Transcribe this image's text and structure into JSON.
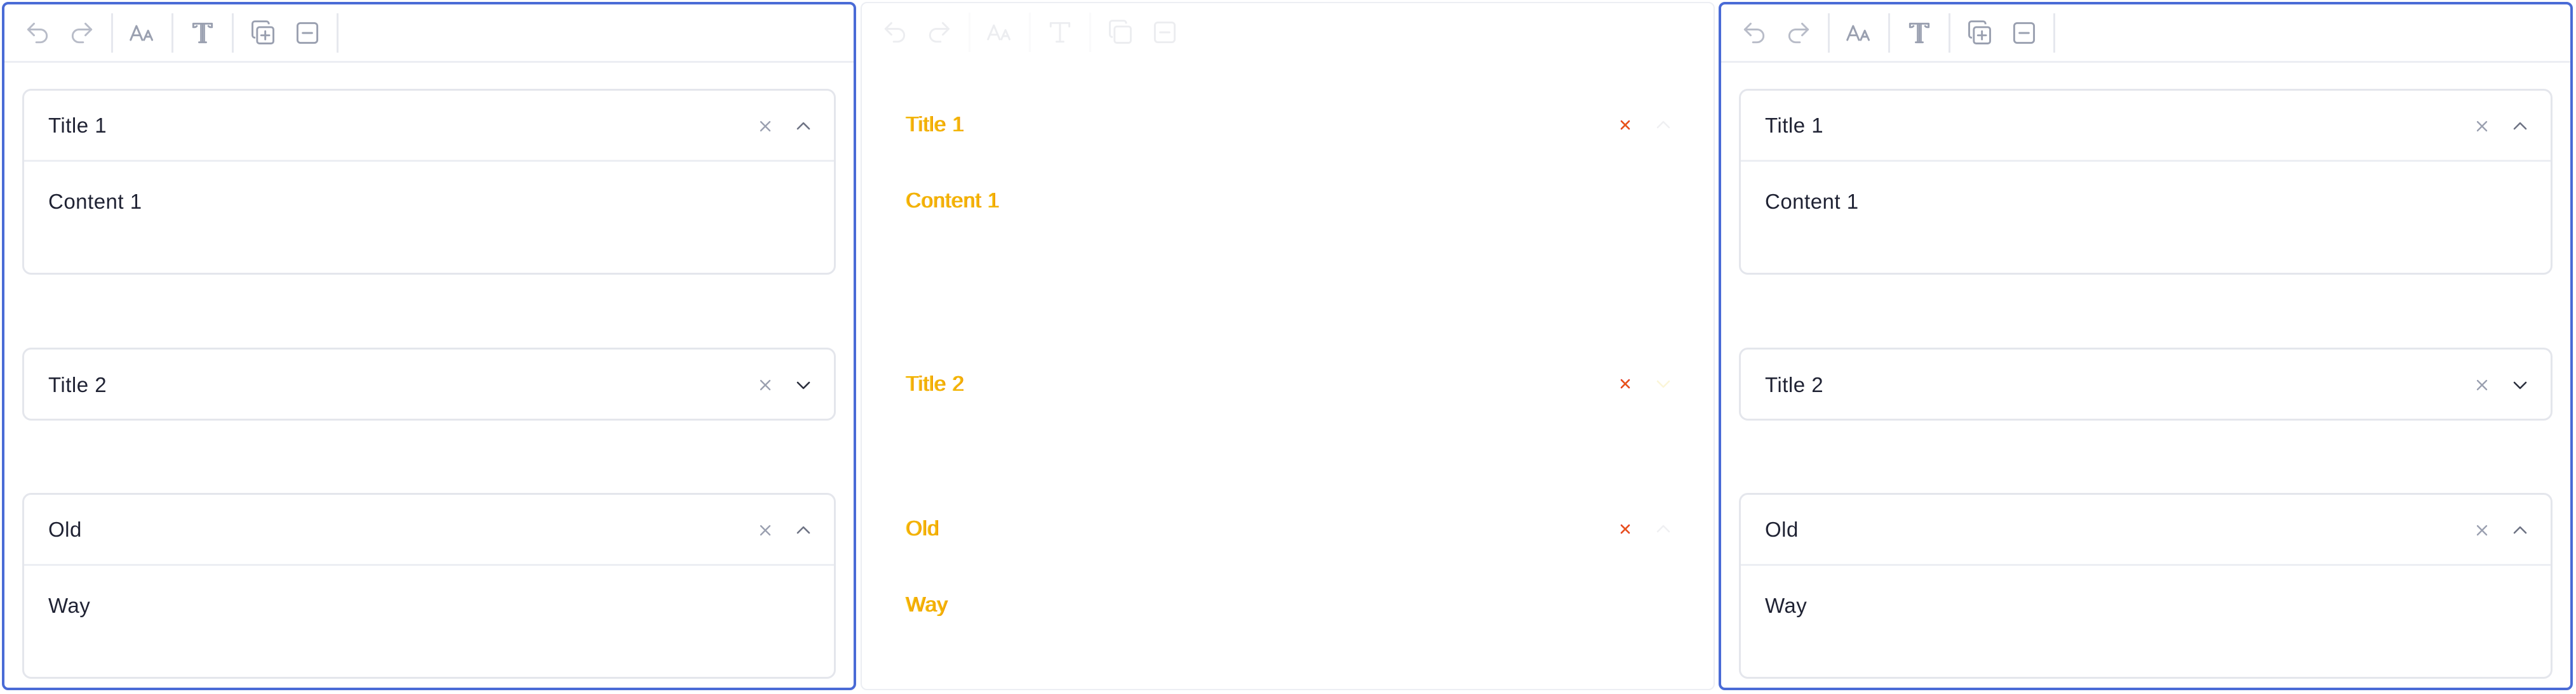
{
  "colors": {
    "frame_active": "#4a6bd6",
    "toolbar_icon": "#9aa0b0",
    "diff_text": "#f2b400",
    "diff_close": "#e02020"
  },
  "toolbar": {
    "icons": [
      "undo-icon",
      "redo-icon",
      "font-size-icon",
      "text-style-icon",
      "duplicate-icon",
      "remove-icon"
    ]
  },
  "panels": {
    "left": {
      "items": [
        {
          "title": "Title 1",
          "content": "Content 1",
          "expanded": true
        },
        {
          "title": "Title 2",
          "content": "",
          "expanded": false
        },
        {
          "title": "Old",
          "content": "Way",
          "expanded": true
        }
      ]
    },
    "diff": {
      "items": [
        {
          "title": "Title 1",
          "content": "Content 1",
          "expanded": true
        },
        {
          "title": "Title 2",
          "content": "",
          "expanded": false
        },
        {
          "title": "Old",
          "content": "Way",
          "expanded": true
        }
      ]
    },
    "right": {
      "items": [
        {
          "title": "Title 1",
          "content": "Content 1",
          "expanded": true
        },
        {
          "title": "Title 2",
          "content": "",
          "expanded": false
        },
        {
          "title": "Old",
          "content": "Way",
          "expanded": true
        }
      ]
    }
  }
}
